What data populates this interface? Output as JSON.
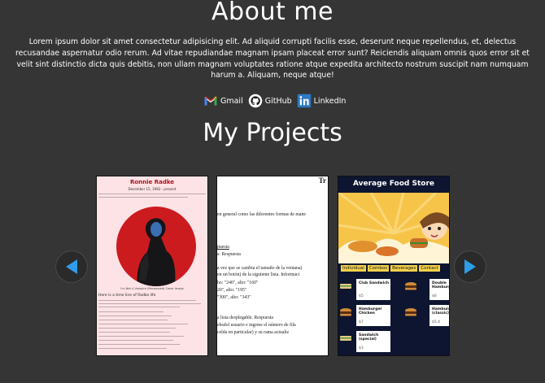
{
  "about": {
    "title": "About me",
    "bio": "Lorem ipsum dolor sit amet consectetur adipisicing elit. Ad aliquid corrupti facilis esse, deserunt neque repellendus, et, delectus recusandae aspernatur odio rerum. Ad vitae repudiandae magnam ipsam placeat error sunt? Reiciendis aliquam omnis quos error sit et velit sint distinctio dicta quis debitis, non ullam magnam voluptates ratione atque expedita architecto nostrum suscipit nam numquam harum a. Aliquam, neque atque!"
  },
  "contacts": [
    {
      "label": "Gmail",
      "icon": "gmail-icon"
    },
    {
      "label": "GitHub",
      "icon": "github-icon"
    },
    {
      "label": "LinkedIn",
      "icon": "linkedin-icon"
    }
  ],
  "projects": {
    "title": "My Projects",
    "cards": [
      {
        "title": "Ronnie Radke",
        "subtitle": "December 15, 1983 - present",
        "caption": "I'm Not A Vampire (Revamped) Cover Image",
        "heading": "Here is a time line of Radke life"
      },
      {
        "corner": "Tr",
        "lines": [
          "en general como las diferentes formas de mane",
          "puesta",
          "s: Respuesta",
          "a vez que se cambia el tamaño de la ventana)",
          "en un botón) de la siguiente lista. Informaci",
          "ho: \"240\", alto: \"160\"",
          "20\", alto: \"195\"",
          "\"300\", alto: \"343\"",
          "a lista desplegable. Respuesta",
          "ebsdol usuario e ingrese el número de fila",
          "celda en particular) y su rama actualiz"
        ]
      },
      {
        "title": "Average Food Store",
        "tabs": [
          "Individual",
          "Combos",
          "Beverages",
          "Contact"
        ],
        "items": [
          {
            "name": "Club Sandwich",
            "price": "$5"
          },
          {
            "name": "Double Hamburger",
            "price": "$6"
          },
          {
            "name": "Hamburger Chicken",
            "price": "$7"
          },
          {
            "name": "Hamburger (classic)",
            "price": "$5.4"
          },
          {
            "name": "Sandwich (special)",
            "price": "$3"
          }
        ]
      }
    ]
  },
  "colors": {
    "background": "#353535",
    "arrow_accent": "#2f9de8",
    "food_accent": "#f5d24b",
    "radke_accent": "#cc1b1f"
  }
}
